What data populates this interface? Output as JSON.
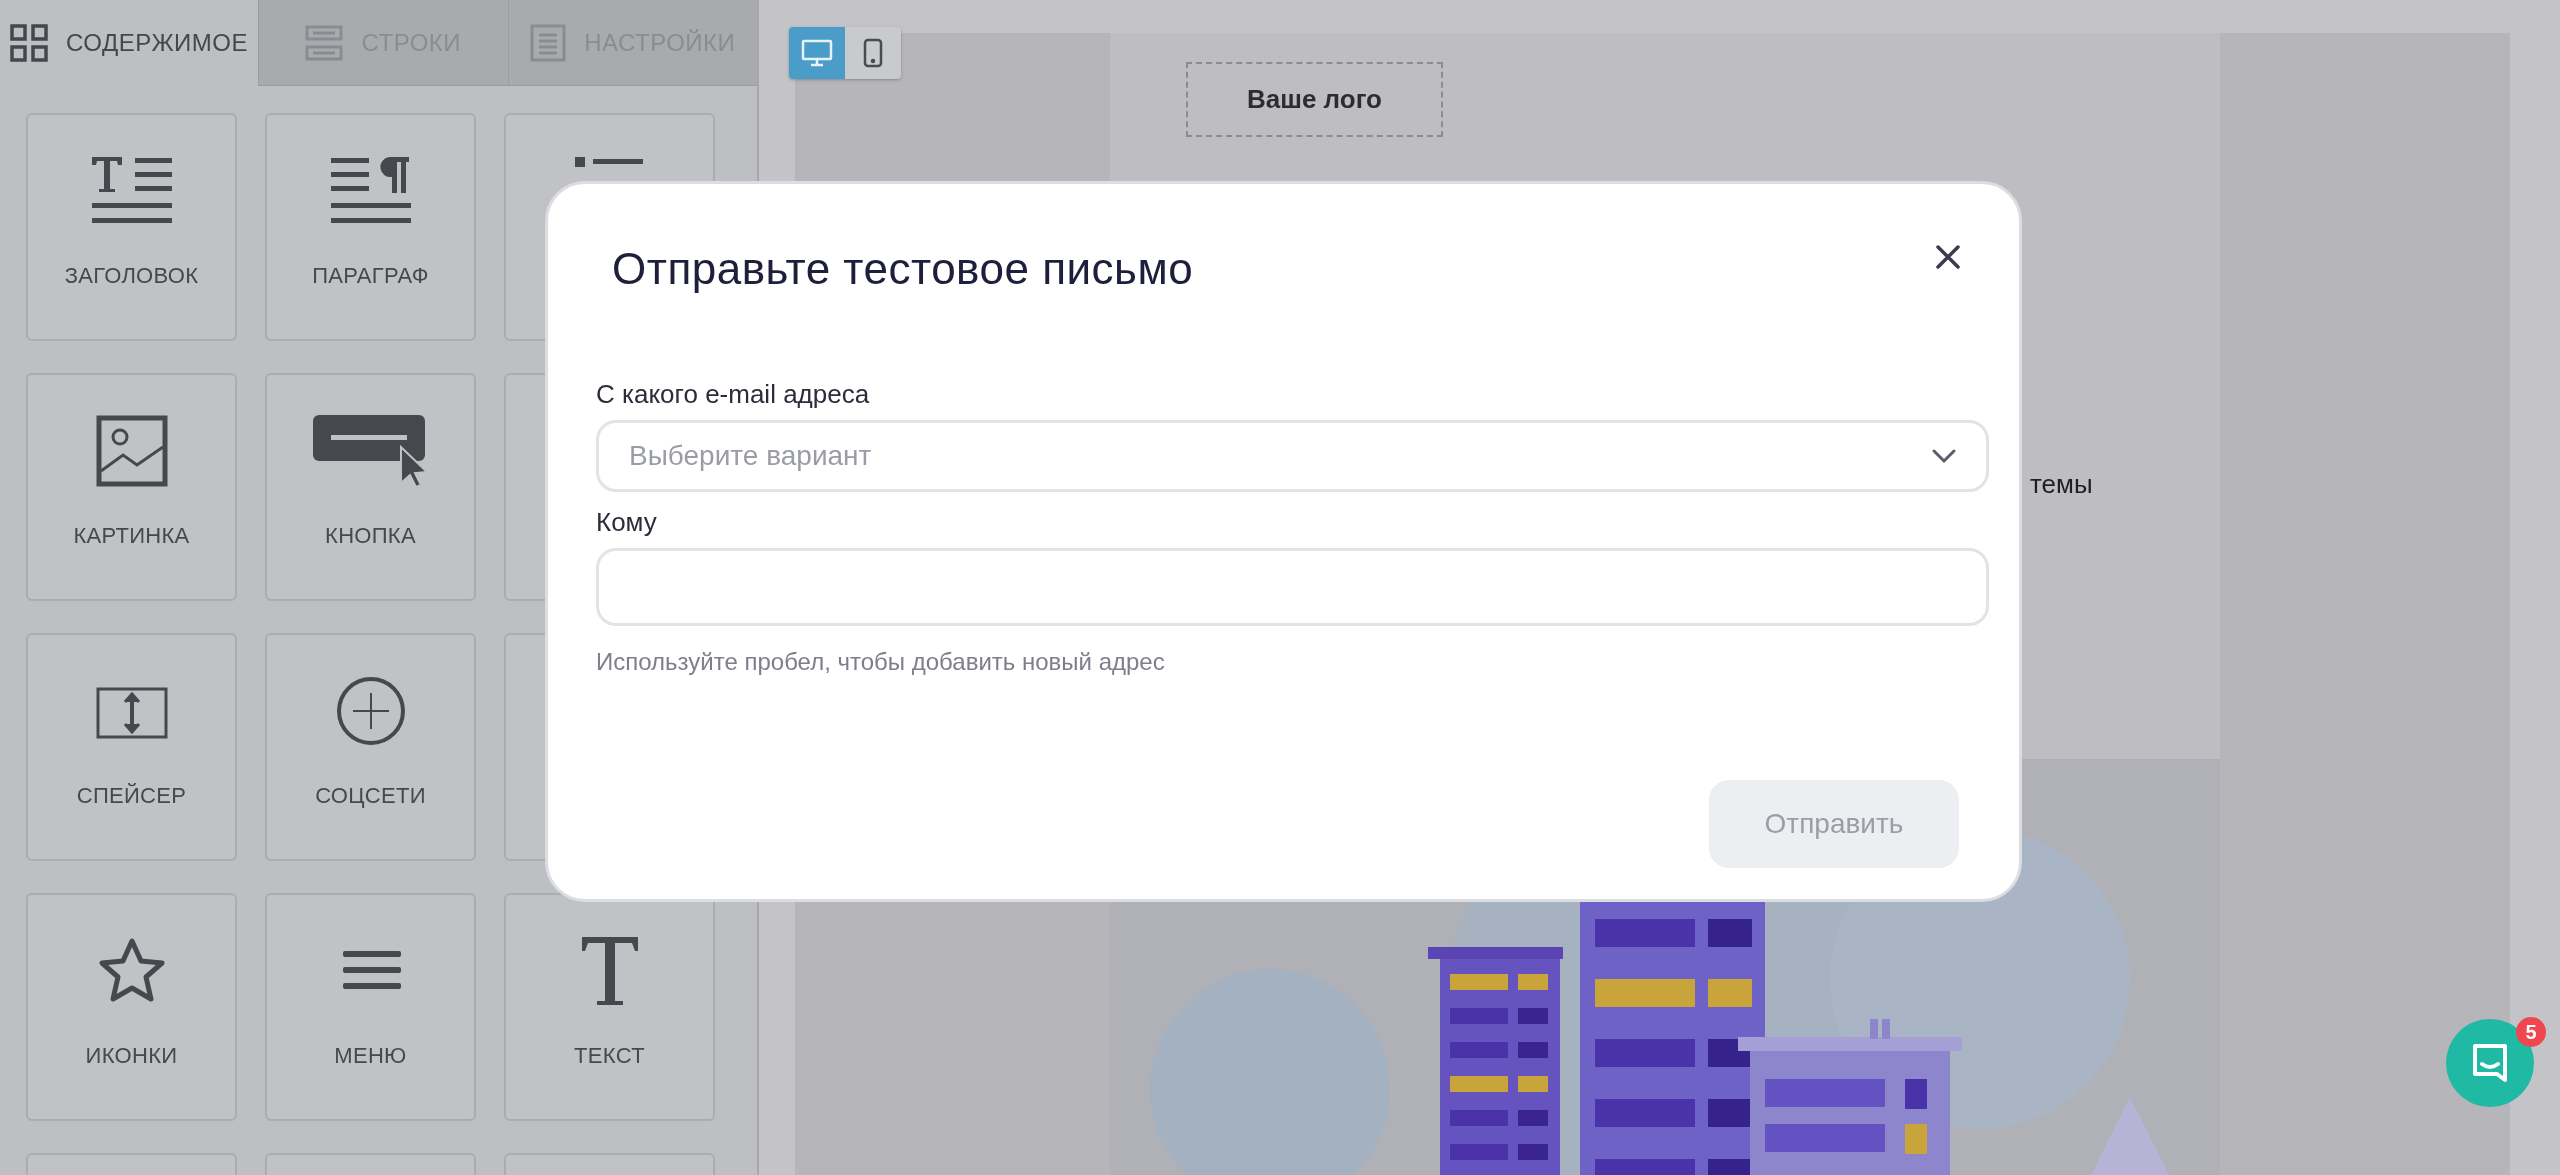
{
  "sidebar": {
    "tabs": [
      {
        "label": "СОДЕРЖИМОЕ",
        "selected": true,
        "kind": "grid"
      },
      {
        "label": "СТРОКИ",
        "selected": false,
        "kind": "rows"
      },
      {
        "label": "НАСТРОЙКИ",
        "selected": false,
        "kind": "doc"
      }
    ],
    "tiles": [
      {
        "kind": "heading",
        "label": "ЗАГОЛОВОК"
      },
      {
        "kind": "paragraph",
        "label": "ПАРАГРАФ"
      },
      {
        "kind": "list"
      },
      {
        "kind": "image",
        "label": "КАРТИНКА"
      },
      {
        "kind": "button",
        "label": "КНОПКА"
      },
      {
        "kind": "blank"
      },
      {
        "kind": "spacer",
        "label": "СПЕЙСЕР"
      },
      {
        "kind": "social",
        "label": "СОЦСЕТИ"
      },
      {
        "kind": "blank"
      },
      {
        "kind": "star",
        "label": "ИКОНКИ"
      },
      {
        "kind": "menu",
        "label": "МЕНЮ"
      },
      {
        "kind": "text",
        "label": "ТЕКСТ"
      },
      {
        "kind": "blank"
      },
      {
        "kind": "blank"
      },
      {
        "kind": "blank"
      }
    ]
  },
  "canvas": {
    "view_modes": [
      {
        "kind": "desktop",
        "selected": true
      },
      {
        "kind": "mobile",
        "selected": false
      }
    ],
    "logo": "Ваше лого",
    "text_fragment": "темы"
  },
  "dialog": {
    "title": "Отправьте тестовое письмо",
    "fields": [
      {
        "kind": "select",
        "label": "С какого e-mail адреса",
        "placeholder": "Выберите вариант"
      },
      {
        "kind": "input",
        "label": "Кому",
        "hint": "Используйте пробел, чтобы добавить новый адрес"
      }
    ],
    "submit": {
      "label": "Отправить",
      "disabled": true
    }
  },
  "chat": {
    "badge": "5"
  }
}
